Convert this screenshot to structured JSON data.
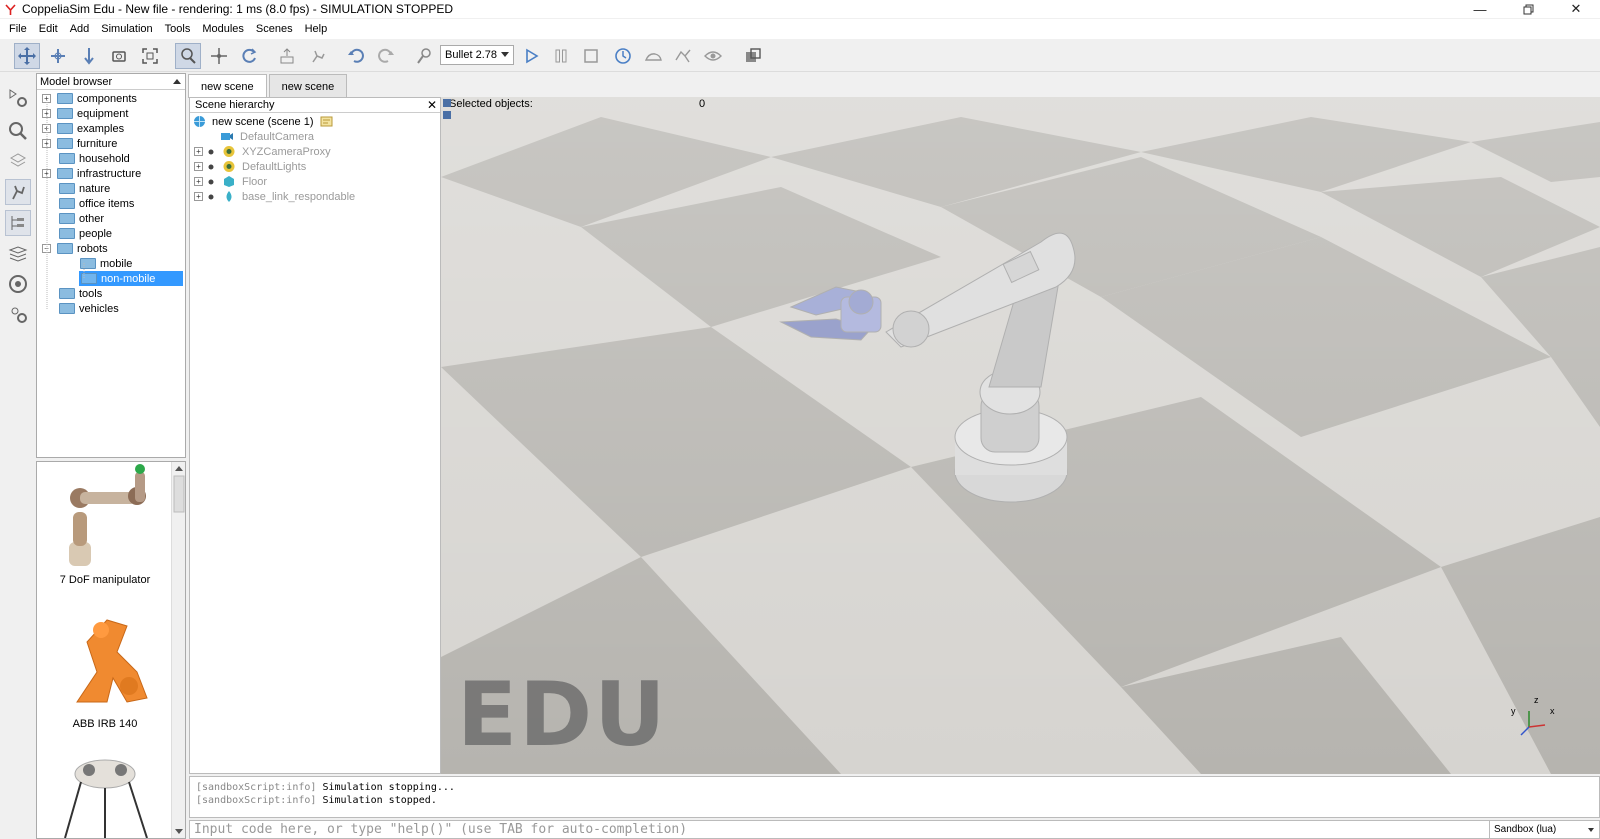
{
  "window": {
    "title": "CoppeliaSim Edu - New file - rendering: 1 ms (8.0 fps) - SIMULATION STOPPED"
  },
  "menu": [
    "File",
    "Edit",
    "Add",
    "Simulation",
    "Tools",
    "Modules",
    "Scenes",
    "Help"
  ],
  "toolbar": {
    "physics_engine": "Bullet 2.78",
    "icons": [
      "move-icon",
      "translate-icon",
      "rotate-icon",
      "camera-fit-icon",
      "fit-view-icon",
      "select-icon",
      "object-shift-icon",
      "object-rotate-icon",
      "assemble-icon",
      "transfer-dna-icon",
      "undo-icon",
      "redo-icon",
      "dynamic-content-icon",
      "engine-dropdown",
      "play-icon",
      "pause-icon",
      "stop-icon",
      "realtime-icon",
      "slow-icon",
      "fast-icon",
      "visualization-icon",
      "page-selector-icon"
    ]
  },
  "model_browser": {
    "title": "Model browser",
    "items": [
      {
        "label": "components",
        "expandable": true
      },
      {
        "label": "equipment",
        "expandable": true
      },
      {
        "label": "examples",
        "expandable": true
      },
      {
        "label": "furniture",
        "expandable": true
      },
      {
        "label": "household",
        "expandable": false
      },
      {
        "label": "infrastructure",
        "expandable": true
      },
      {
        "label": "nature",
        "expandable": false
      },
      {
        "label": "office items",
        "expandable": false
      },
      {
        "label": "other",
        "expandable": false
      },
      {
        "label": "people",
        "expandable": false
      },
      {
        "label": "robots",
        "expandable": true,
        "expanded": true
      },
      {
        "label": "mobile",
        "child": true
      },
      {
        "label": "non-mobile",
        "child": true,
        "selected": true
      },
      {
        "label": "tools",
        "expandable": false
      },
      {
        "label": "vehicles",
        "expandable": false
      }
    ]
  },
  "thumbnails": [
    {
      "label": "7 DoF manipulator"
    },
    {
      "label": "ABB IRB 140"
    },
    {
      "label": ""
    }
  ],
  "tabs": [
    {
      "label": "new scene",
      "active": true
    },
    {
      "label": "new scene",
      "active": false
    }
  ],
  "scene_hierarchy": {
    "title": "Scene hierarchy",
    "root": "new scene (scene 1)",
    "items": [
      "DefaultCamera",
      "XYZCameraProxy",
      "DefaultLights",
      "Floor",
      "base_link_respondable"
    ]
  },
  "viewport": {
    "selected_label": "Selected objects:",
    "selected_count": "0",
    "watermark": "EDU",
    "axes": {
      "x": "x",
      "y": "y",
      "z": "z"
    }
  },
  "console": {
    "lines": [
      {
        "tag": "[sandboxScript:info]",
        "text": "Simulation stopping..."
      },
      {
        "tag": "[sandboxScript:info]",
        "text": "Simulation stopped."
      }
    ]
  },
  "input": {
    "placeholder": "Input code here, or type \"help()\" (use TAB for auto-completion)",
    "sandbox": "Sandbox (lua)"
  },
  "colors": {
    "selection": "#3399ff",
    "folder": "#8bbce0",
    "floor_light": "#d9d7d3",
    "floor_dark": "#b5b3ae"
  }
}
